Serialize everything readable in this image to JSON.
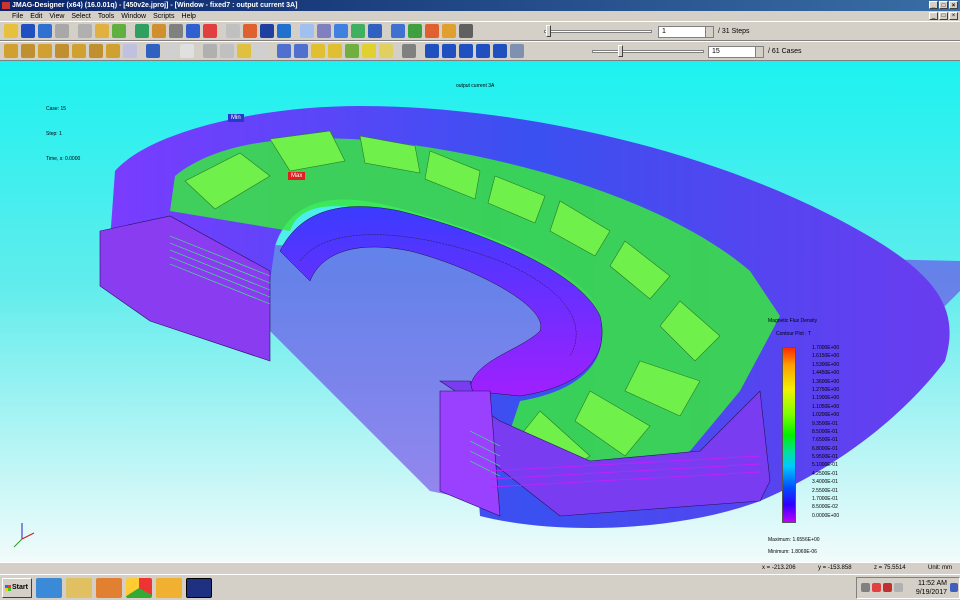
{
  "window": {
    "title": "JMAG-Designer (x64) (16.0.01q) - [450v2e.jproj] - [Window - fixed7 : output current 3A]",
    "controls": [
      "_",
      "□",
      "×"
    ]
  },
  "menu": {
    "items": [
      "File",
      "Edit",
      "View",
      "Select",
      "Tools",
      "Window",
      "Scripts",
      "Help"
    ]
  },
  "toolbar": {
    "step_value": "1",
    "step_suffix": "/ 31 Steps",
    "case_value": "15",
    "case_suffix": "/ 61 Cases"
  },
  "viewport": {
    "plot_title": "output current 3A",
    "case_label": "Case: 15",
    "step_label": "Step: 1",
    "time_label": "Time, s: 0.0000",
    "min_marker": "Min",
    "max_marker": "Max",
    "axes_glyph": "XYZ"
  },
  "legend": {
    "title": "Magnetic Flux Density",
    "subtitle": "Contour Plot : T",
    "ticks": [
      "1.7000E+00",
      "1.6150E+00",
      "1.5300E+00",
      "1.4450E+00",
      "1.3600E+00",
      "1.2750E+00",
      "1.1900E+00",
      "1.1050E+00",
      "1.0200E+00",
      "9.3500E-01",
      "8.5000E-01",
      "7.6500E-01",
      "6.8000E-01",
      "5.9500E-01",
      "5.1000E-01",
      "4.2500E-01",
      "3.4000E-01",
      "2.5500E-01",
      "1.7000E-01",
      "8.5000E-02",
      "0.0000E+00"
    ],
    "maximum": "Maximum: 1.6556E+00",
    "minimum": "Minimum: 1.8069E-06"
  },
  "statusbar": {
    "x": "x = -213.206",
    "y": "y = -153.858",
    "z": "z = 75.5514",
    "unit": "Unit: mm"
  },
  "taskbar": {
    "start": "Start",
    "time": "11:52 AM",
    "date": "9/19/2017"
  }
}
